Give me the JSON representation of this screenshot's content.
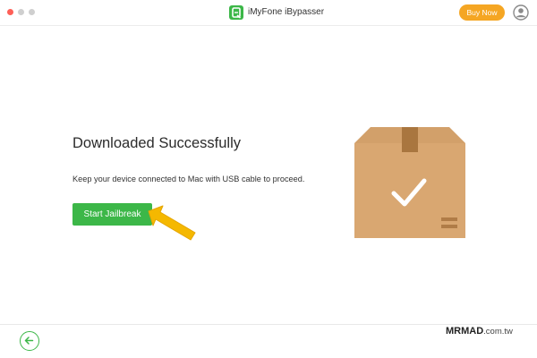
{
  "window": {
    "app_title": "iMyFone iBypasser",
    "buy_button": "Buy Now",
    "traffic_lights": [
      "close",
      "minimize",
      "maximize"
    ],
    "colors": {
      "accent_green": "#3cb748",
      "buy_orange": "#f5a623",
      "close_red": "#fe5f57"
    }
  },
  "main": {
    "heading": "Downloaded Successfully",
    "description": "Keep your device connected to Mac with USB cable to proceed.",
    "start_button": "Start Jailbreak",
    "illustration_icon": "package-check-icon",
    "pointer_icon": "yellow-arrow-icon"
  },
  "footer": {
    "back_icon": "arrow-left-circle-icon"
  },
  "watermark": {
    "brand": "MRMAD",
    "domain": ".com.tw"
  }
}
